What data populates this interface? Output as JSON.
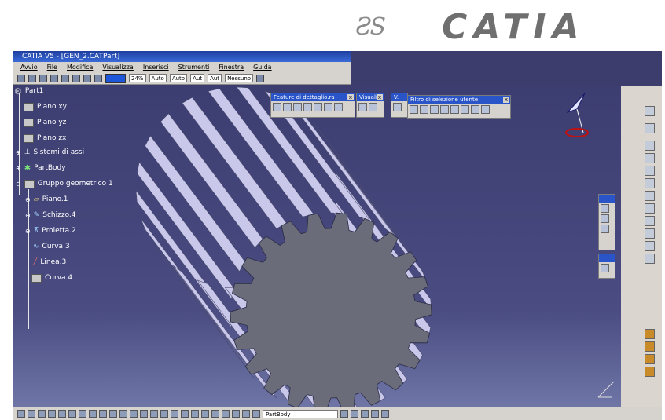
{
  "logo": {
    "mark": "ƧS",
    "word": "CATIA"
  },
  "window": {
    "title": "CATIA V5 - [GEN_2.CATPart]"
  },
  "menu": [
    "Avvio",
    "File",
    "Modifica",
    "Visualizza",
    "Inserisci",
    "Strumenti",
    "Finestra",
    "Guida"
  ],
  "toolbar": {
    "zoom_value": "24%",
    "linetype": "Auto",
    "thickness": "Auto",
    "point": "Aut",
    "auto2": "Aut",
    "layer": "Nessuno"
  },
  "tree": {
    "root": "Part1",
    "items": [
      "Piano xy",
      "Piano yz",
      "Piano zx",
      "Sistemi di assi",
      "PartBody",
      "Gruppo geometrico 1",
      "Piano.1",
      "Schizzo.4",
      "Proietta.2",
      "Curva.3",
      "Linea.3",
      "Curva.4"
    ]
  },
  "floating": {
    "features": {
      "title": "Feature di dettaglio.ra"
    },
    "view": {
      "title": "Visuali"
    },
    "small": {
      "title": "V."
    },
    "selection": {
      "title": "Filtro di selezione utente"
    }
  },
  "status": {
    "layer_value": "PartBody"
  },
  "colors": {
    "viewport_top": "#3c3d70",
    "viewport_bottom": "#6f76a6",
    "gear_fill": "#c9c7ea",
    "gear_face": "#6b6c7a",
    "accent": "#1d56d8"
  }
}
